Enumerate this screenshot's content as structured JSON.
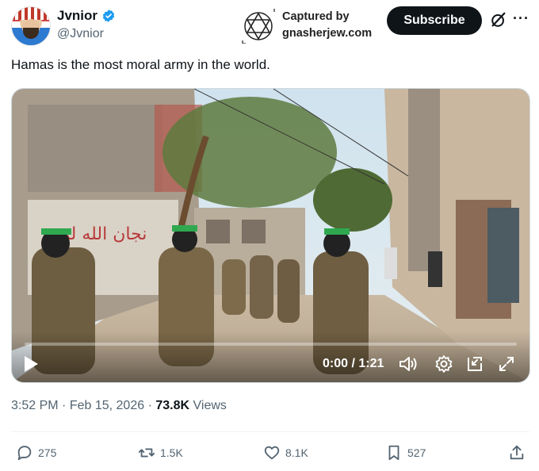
{
  "author": {
    "display_name": "Jvnior",
    "handle": "@Jvnior",
    "verified": true
  },
  "watermark": {
    "line1": "Captured by",
    "line2": "gnasherjew.com"
  },
  "buttons": {
    "subscribe_label": "Subscribe",
    "more_label": "···"
  },
  "tweet": {
    "text": "Hamas is the most moral army in the world.",
    "time": "3:52 PM",
    "date": "Feb 15, 2026",
    "views_count": "73.8K",
    "views_label": "Views",
    "separator": "·"
  },
  "video": {
    "time_display": "0:00 / 1:21",
    "progress": 0.0,
    "wall_text": "نجان الله لم"
  },
  "actions": {
    "replies": "275",
    "reposts": "1.5K",
    "likes": "8.1K",
    "bookmarks": "527"
  },
  "colors": {
    "text_primary": "#0f1419",
    "text_secondary": "#536471",
    "verified_blue": "#1d9bf0",
    "subscribe_bg": "#0f1419"
  },
  "icons": [
    "verified-badge-icon",
    "star-of-david-logo",
    "grok-icon",
    "more-icon",
    "play-icon",
    "volume-icon",
    "settings-icon",
    "pip-icon",
    "fullscreen-icon",
    "reply-icon",
    "repost-icon",
    "like-icon",
    "bookmark-icon",
    "share-icon"
  ]
}
